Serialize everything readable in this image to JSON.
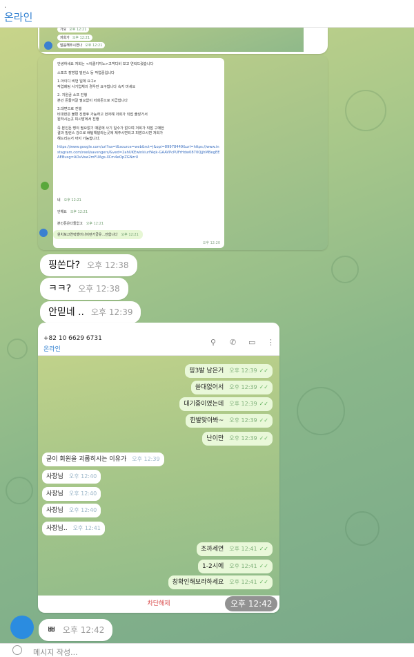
{
  "header": {
    "dot": ".",
    "status": "온라인"
  },
  "shot1": {
    "rows": [
      {
        "text": "가요",
        "time": "오후 12:21"
      },
      {
        "text": "저희가",
        "time": "오후 12:21"
      },
      {
        "text": "말씀해주시면나",
        "time": "오후 12:21"
      }
    ]
  },
  "shot2": {
    "paragraphs": [
      "안녕하세요 저희는 <이클키지노>고객디비 보고 연락드렸습니다",
      "스포츠 장방업 빌런스 등 작업중입니다",
      "1.아이디 비번 일체 요구x\n작업배팅 사기업체의 경우만 요구합니다 속지 마세요",
      "2. 지원금 소프 진행\n본인 돈들어갈 필요없이 저희돈으로 지급합니다",
      "3.대면으로 진행\n비대면은 불편 진행후 가능하고 먼저해 저희가 직접 출장가서\n원하시는곳 피시방에서 진행",
      "즉 본인돈 명의 필요없기 때문에 사기 일수가 없으며 저희가 직접 구매한\n결과 빌런스 강으로 배팅해달라는곳에 제주시면되고 피방으시면 저희가\n해드리는거 까지 가능합니다."
    ],
    "link": "https://www.google.com/url?sa=t&source=web&rct=j&opi=89978449&url=https://www.instagram.com/reel/savengers/&ved=2ahUKEwinkiurFAqk-GAAVPcPUFrHdw0870QjjhMBegEEAEBusg=AOvVaw2mFUAgs-XCm4eOpZGNzrU",
    "link_time": "오후 12:20",
    "replies": [
      {
        "text": "네",
        "time": "오후 12:21"
      },
      {
        "text": "안해요",
        "time": "오후 12:21"
      },
      {
        "text": "본인돈은다들없고",
        "time": "오후 12:21"
      },
      {
        "text": "원치보고연락했어나이런거궁유...안합니다",
        "time": "오후 12:21"
      }
    ]
  },
  "messages": [
    {
      "text": "핑쏜다?",
      "time": "오후 12:38"
    },
    {
      "text": "ㅋㅋ?",
      "time": "오후 12:38"
    },
    {
      "text": "안믿네 ..",
      "time": "오후 12:39"
    }
  ],
  "phone": {
    "number": "+82 10 6629 6731",
    "status": "온라인",
    "icons": [
      "search-icon",
      "phone-icon",
      "layout-icon",
      "more-icon"
    ],
    "outgoing1": [
      {
        "text": "핑3발 남은거",
        "time": "오후 12:39"
      },
      {
        "text": "쓸대없어서",
        "time": "오후 12:39"
      },
      {
        "text": "대기중이였는데",
        "time": "오후 12:39"
      },
      {
        "text": "한발맞아봐~",
        "time": "오후 12:39"
      },
      {
        "text": "난이만",
        "time": "오후 12:39"
      }
    ],
    "incoming": [
      {
        "text": "굳이 회원을 괴롭히시는 이유가",
        "time": "오후 12:39"
      },
      {
        "text": "사장님",
        "time": "오후 12:40"
      },
      {
        "text": "사장님",
        "time": "오후 12:40"
      },
      {
        "text": "사장님",
        "time": "오후 12:40"
      },
      {
        "text": "사장님..",
        "time": "오후 12:41"
      }
    ],
    "outgoing2": [
      {
        "text": "조까세연",
        "time": "오후 12:41"
      },
      {
        "text": "1-2시에",
        "time": "오후 12:41"
      },
      {
        "text": "창확인해보라하세요",
        "time": "오후 12:41"
      }
    ],
    "unblock": "차단해제",
    "image_time": "오후 12:42"
  },
  "last_message": {
    "text": "ㅃ",
    "time": "오후 12:42"
  },
  "composer": {
    "placeholder": "메시지 작성..."
  }
}
